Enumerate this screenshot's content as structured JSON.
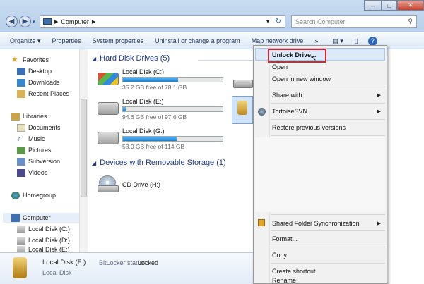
{
  "address": {
    "crumb": "Computer"
  },
  "search": {
    "placeholder": "Search Computer"
  },
  "toolbar": {
    "organize": "Organize ▾",
    "properties": "Properties",
    "system_properties": "System properties",
    "uninstall": "Uninstall or change a program",
    "map_drive": "Map network drive",
    "more": "»"
  },
  "nav": {
    "favorites": "Favorites",
    "desktop": "Desktop",
    "downloads": "Downloads",
    "recent": "Recent Places",
    "libraries": "Libraries",
    "documents": "Documents",
    "music": "Music",
    "pictures": "Pictures",
    "subversion": "Subversion",
    "videos": "Videos",
    "homegroup": "Homegroup",
    "computer": "Computer",
    "disk_c": "Local Disk (C:)",
    "disk_d": "Local Disk (D:)",
    "disk_e": "Local Disk (E:)"
  },
  "main": {
    "hdd_group": "Hard Disk Drives (5)",
    "removable_group": "Devices with Removable Storage (1)",
    "drives": [
      {
        "name": "Local Disk (C:)",
        "free": "35.2 GB free of 78.1 GB",
        "used_fraction": 0.55
      },
      {
        "name": "Local Disk (E:)",
        "free": "94.6 GB free of 97.6 GB",
        "used_fraction": 0.03
      },
      {
        "name": "Local Disk (G:)",
        "free": "53.0 GB free of 114 GB",
        "used_fraction": 0.54
      }
    ],
    "cd": "CD Drive (H:)"
  },
  "menu": {
    "unlock": "Unlock Drive...",
    "open": "Open",
    "open_new": "Open in new window",
    "share": "Share with",
    "tortoise": "TortoiseSVN",
    "restore": "Restore previous versions",
    "shared_sync": "Shared Folder Synchronization",
    "format": "Format...",
    "copy": "Copy",
    "shortcut": "Create shortcut",
    "rename": "Rename"
  },
  "details": {
    "name": "Local Disk (F:)",
    "bitlocker_label": "BitLocker status:",
    "bitlocker_value": "Locked",
    "type": "Local Disk"
  },
  "colors": {
    "highlight_border": "#e0202a",
    "bar_fill": "#1c7fd2",
    "group_text": "#1e3a8a"
  }
}
